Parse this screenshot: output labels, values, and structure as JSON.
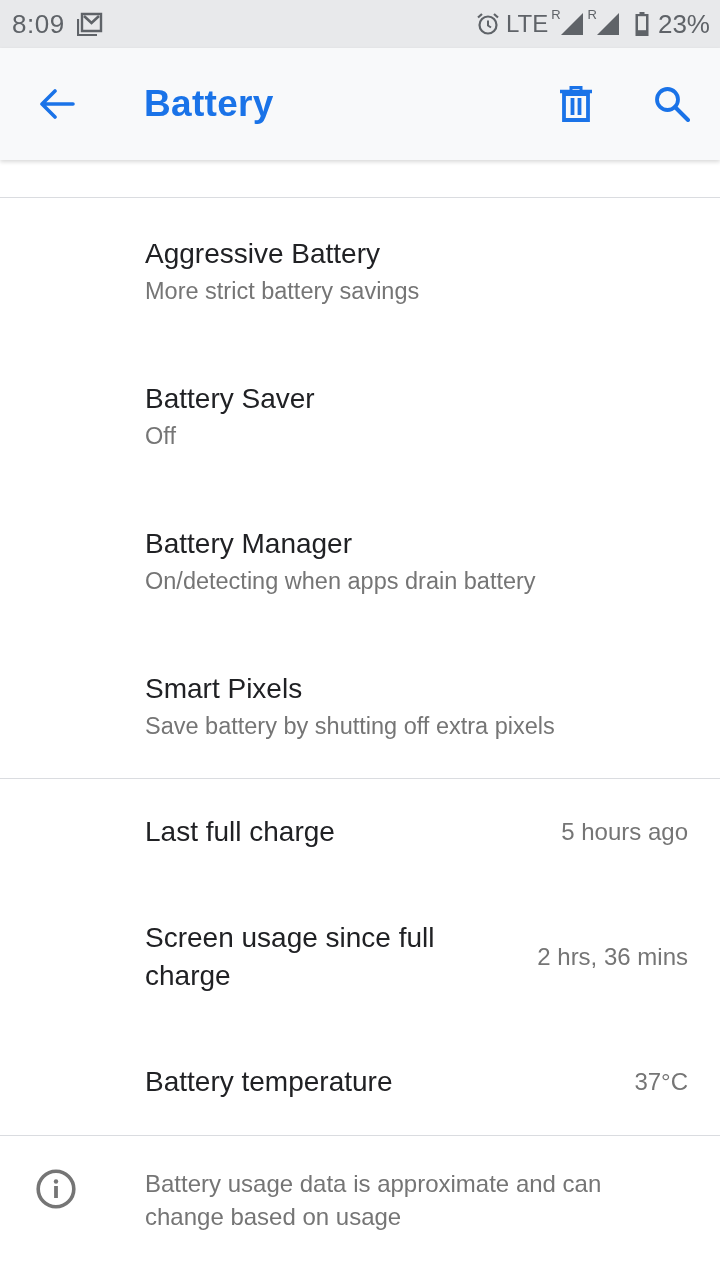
{
  "status_bar": {
    "time": "8:09",
    "network": "LTE",
    "roaming_marks": [
      "R",
      "R"
    ],
    "battery": "23%"
  },
  "app_bar": {
    "title": "Battery"
  },
  "settings": [
    {
      "title": "Aggressive Battery",
      "summary": "More strict battery savings"
    },
    {
      "title": "Battery Saver",
      "summary": "Off"
    },
    {
      "title": "Battery Manager",
      "summary": "On/detecting when apps drain battery"
    },
    {
      "title": "Smart Pixels",
      "summary": "Save battery by shutting off extra pixels"
    }
  ],
  "stats": [
    {
      "label": "Last full charge",
      "value": "5 hours ago"
    },
    {
      "label": "Screen usage since full charge",
      "value": "2 hrs, 36 mins"
    },
    {
      "label": "Battery temperature",
      "value": "37°C"
    }
  ],
  "footer": {
    "text": "Battery usage data is approximate and can change based on usage"
  }
}
